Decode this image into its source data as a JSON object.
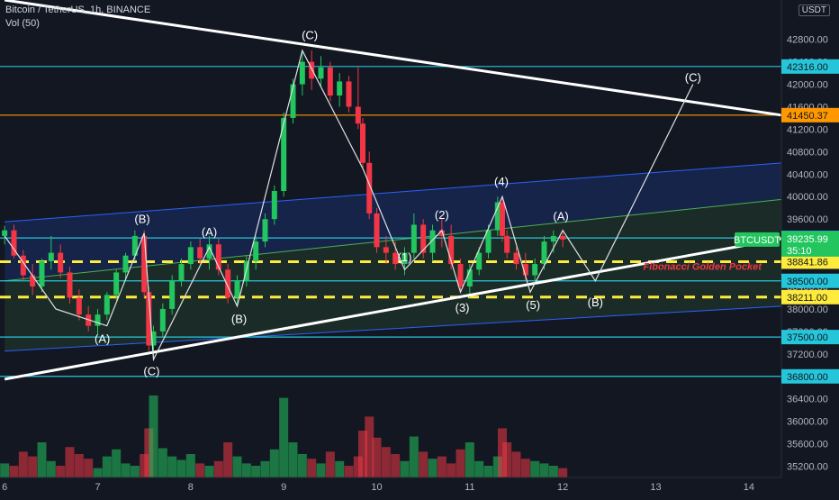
{
  "header": {
    "symbol": "Bitcoin / TetherUS, 1h, BINANCE",
    "volume": "Vol (50)"
  },
  "currency_button": "USDT",
  "price_axis": {
    "ticks": [
      "42800.00",
      "42400.00",
      "42000.00",
      "41600.00",
      "41200.00",
      "40800.00",
      "40400.00",
      "40000.00",
      "39600.00",
      "39200.00",
      "38800.00",
      "38400.00",
      "38000.00",
      "37600.00",
      "37200.00",
      "36800.00",
      "36400.00",
      "36000.00",
      "35600.00",
      "35200.00"
    ]
  },
  "time_axis": {
    "ticks": [
      "6",
      "7",
      "8",
      "9",
      "10",
      "11",
      "12",
      "13",
      "14"
    ]
  },
  "chart_data": {
    "type": "candlestick",
    "symbol": "BTCUSDT",
    "interval": "1h",
    "exchange": "BINANCE",
    "ylim": [
      35000,
      43500
    ],
    "xlim": [
      5.95,
      14.35
    ],
    "candles": [
      [
        6.0,
        39300,
        39480,
        39150,
        39400
      ],
      [
        6.1,
        39400,
        39500,
        38900,
        38950
      ],
      [
        6.2,
        38950,
        39050,
        38500,
        38600
      ],
      [
        6.3,
        38600,
        38800,
        38250,
        38400
      ],
      [
        6.4,
        38400,
        38900,
        38300,
        38850
      ],
      [
        6.5,
        38850,
        39300,
        38700,
        39000
      ],
      [
        6.6,
        39000,
        39150,
        38550,
        38650
      ],
      [
        6.7,
        38650,
        38750,
        38100,
        38200
      ],
      [
        6.8,
        38200,
        38350,
        37800,
        37900
      ],
      [
        6.9,
        37900,
        38050,
        37600,
        37700
      ],
      [
        7.0,
        37700,
        38000,
        37550,
        37900
      ],
      [
        7.1,
        37900,
        38300,
        37800,
        38250
      ],
      [
        7.2,
        38250,
        38700,
        38150,
        38650
      ],
      [
        7.3,
        38650,
        39000,
        38500,
        38950
      ],
      [
        7.4,
        38950,
        39400,
        38850,
        39300
      ],
      [
        7.5,
        39300,
        39400,
        38200,
        38300
      ],
      [
        7.55,
        38300,
        38400,
        37250,
        37350
      ],
      [
        7.6,
        37350,
        37700,
        37100,
        37600
      ],
      [
        7.7,
        37600,
        38100,
        37500,
        38000
      ],
      [
        7.8,
        38000,
        38600,
        37900,
        38500
      ],
      [
        7.9,
        38500,
        38900,
        38400,
        38800
      ],
      [
        8.0,
        38800,
        39200,
        38700,
        39100
      ],
      [
        8.1,
        39100,
        39250,
        38800,
        38900
      ],
      [
        8.2,
        38900,
        39300,
        38700,
        39150
      ],
      [
        8.3,
        39150,
        39250,
        38600,
        38700
      ],
      [
        8.4,
        38700,
        38800,
        38100,
        38200
      ],
      [
        8.5,
        38200,
        38600,
        38050,
        38500
      ],
      [
        8.6,
        38500,
        38950,
        38400,
        38850
      ],
      [
        8.7,
        38850,
        39300,
        38700,
        39200
      ],
      [
        8.8,
        39200,
        39700,
        39100,
        39600
      ],
      [
        8.9,
        39600,
        40200,
        39500,
        40100
      ],
      [
        9.0,
        40100,
        41500,
        40000,
        41400
      ],
      [
        9.1,
        41400,
        42100,
        41300,
        42000
      ],
      [
        9.2,
        42000,
        42600,
        41800,
        42400
      ],
      [
        9.3,
        42400,
        42600,
        41900,
        42100
      ],
      [
        9.4,
        42100,
        42500,
        41950,
        42300
      ],
      [
        9.5,
        42300,
        42400,
        41700,
        41800
      ],
      [
        9.6,
        41800,
        42200,
        41600,
        42050
      ],
      [
        9.7,
        42050,
        42150,
        41500,
        41600
      ],
      [
        9.8,
        41600,
        42300,
        41200,
        41300
      ],
      [
        9.85,
        41300,
        41400,
        40500,
        40600
      ],
      [
        9.92,
        40600,
        40800,
        39600,
        39700
      ],
      [
        10.0,
        39700,
        39800,
        39000,
        39100
      ],
      [
        10.1,
        39100,
        39300,
        38800,
        39000
      ],
      [
        10.2,
        39000,
        39200,
        38700,
        38800
      ],
      [
        10.3,
        38800,
        39100,
        38600,
        39000
      ],
      [
        10.4,
        39000,
        39700,
        38900,
        39500
      ],
      [
        10.5,
        39500,
        39600,
        38900,
        39000
      ],
      [
        10.6,
        39000,
        39500,
        38850,
        39400
      ],
      [
        10.7,
        39400,
        39600,
        39100,
        39300
      ],
      [
        10.8,
        39300,
        39500,
        38700,
        38800
      ],
      [
        10.9,
        38800,
        38900,
        38300,
        38400
      ],
      [
        11.0,
        38400,
        38800,
        38200,
        38700
      ],
      [
        11.1,
        38700,
        39100,
        38600,
        39000
      ],
      [
        11.2,
        39000,
        39500,
        38900,
        39400
      ],
      [
        11.3,
        39400,
        40000,
        39300,
        39900
      ],
      [
        11.35,
        39900,
        40000,
        39200,
        39300
      ],
      [
        11.4,
        39300,
        39400,
        38900,
        39000
      ],
      [
        11.5,
        39000,
        39100,
        38700,
        38800
      ],
      [
        11.6,
        38800,
        39000,
        38500,
        38600
      ],
      [
        11.7,
        38600,
        38900,
        38500,
        38800
      ],
      [
        11.8,
        38800,
        39300,
        38700,
        39200
      ],
      [
        11.9,
        39200,
        39400,
        39000,
        39300
      ],
      [
        12.0,
        39300,
        39400,
        39100,
        39236
      ]
    ],
    "volume_ylim": [
      0,
      100
    ],
    "volume": [
      12,
      10,
      22,
      18,
      30,
      14,
      10,
      26,
      20,
      16,
      8,
      18,
      24,
      12,
      10,
      20,
      42,
      70,
      25,
      18,
      15,
      20,
      12,
      10,
      14,
      30,
      18,
      12,
      10,
      14,
      24,
      68,
      30,
      20,
      16,
      12,
      22,
      14,
      10,
      18,
      40,
      52,
      34,
      26,
      20,
      14,
      35,
      22,
      16,
      18,
      12,
      24,
      30,
      14,
      10,
      18,
      42,
      30,
      22,
      16,
      14,
      12,
      10,
      8
    ],
    "wave_path": [
      [
        6.0,
        39300
      ],
      [
        6.55,
        38000
      ],
      [
        7.1,
        37700
      ],
      [
        7.5,
        39350
      ],
      [
        7.6,
        37100
      ],
      [
        8.2,
        39100
      ],
      [
        8.5,
        38050
      ],
      [
        9.2,
        42600
      ],
      [
        9.85,
        40500
      ],
      [
        10.3,
        38700
      ],
      [
        10.7,
        39400
      ],
      [
        10.9,
        38300
      ],
      [
        11.35,
        40000
      ],
      [
        11.65,
        38300
      ],
      [
        12.0,
        39400
      ],
      [
        12.35,
        38500
      ],
      [
        13.4,
        42000
      ]
    ],
    "wave_labels": [
      {
        "text": "(A)",
        "x": 7.05,
        "y": 37400
      },
      {
        "text": "(B)",
        "x": 7.48,
        "y": 39530
      },
      {
        "text": "(C)",
        "x": 7.58,
        "y": 36820
      },
      {
        "text": "(A)",
        "x": 8.2,
        "y": 39300
      },
      {
        "text": "(B)",
        "x": 8.52,
        "y": 37750
      },
      {
        "text": "(C)",
        "x": 9.28,
        "y": 42800
      },
      {
        "text": "(1)",
        "x": 10.3,
        "y": 38850
      },
      {
        "text": "(2)",
        "x": 10.7,
        "y": 39600
      },
      {
        "text": "(3)",
        "x": 10.92,
        "y": 37950
      },
      {
        "text": "(4)",
        "x": 11.34,
        "y": 40200
      },
      {
        "text": "(5)",
        "x": 11.68,
        "y": 38000
      },
      {
        "text": "(A)",
        "x": 11.98,
        "y": 39580
      },
      {
        "text": "(B)",
        "x": 12.35,
        "y": 38050
      },
      {
        "text": "(C)",
        "x": 13.4,
        "y": 42050
      }
    ],
    "horizontal_levels": [
      {
        "value": 42316.0,
        "color": "#26c6da",
        "label": "42316.00"
      },
      {
        "value": 41450.37,
        "color": "#ff9800",
        "label": "41450.37"
      },
      {
        "value": 39264.0,
        "color": "#26c6da",
        "label": "39264.00"
      },
      {
        "value": 38841.86,
        "color": "#ffeb3b",
        "label": "38841.86",
        "dashed": true
      },
      {
        "value": 38500.0,
        "color": "#26c6da",
        "label": "38500.00"
      },
      {
        "value": 38211.0,
        "color": "#ffeb3b",
        "label": "38211.00",
        "dashed": true
      },
      {
        "value": 37500.0,
        "color": "#26c6da",
        "label": "37500.00"
      },
      {
        "value": 36800.0,
        "color": "#26c6da",
        "label": "36800.00"
      }
    ],
    "last_price": {
      "symbol": "BTCUSDT",
      "value": "39235.99",
      "countdown": "35:10"
    },
    "annotation": "Fibonacci Golden Pocket",
    "trendlines": [
      {
        "from": [
          6.0,
          43500
        ],
        "to": [
          14.35,
          41450
        ],
        "color": "#ffffff"
      },
      {
        "from": [
          6.0,
          36750
        ],
        "to": [
          14.35,
          39250
        ],
        "color": "#ffffff"
      }
    ],
    "channel": {
      "upper": [
        [
          6.0,
          39550
        ],
        [
          14.35,
          40600
        ]
      ],
      "mid": [
        [
          6.0,
          38500
        ],
        [
          14.35,
          39950
        ]
      ],
      "lower": [
        [
          6.0,
          37250
        ],
        [
          14.35,
          38050
        ]
      ]
    },
    "colors": {
      "up": "#22c55e",
      "down": "#f23645",
      "background": "#131722"
    }
  }
}
